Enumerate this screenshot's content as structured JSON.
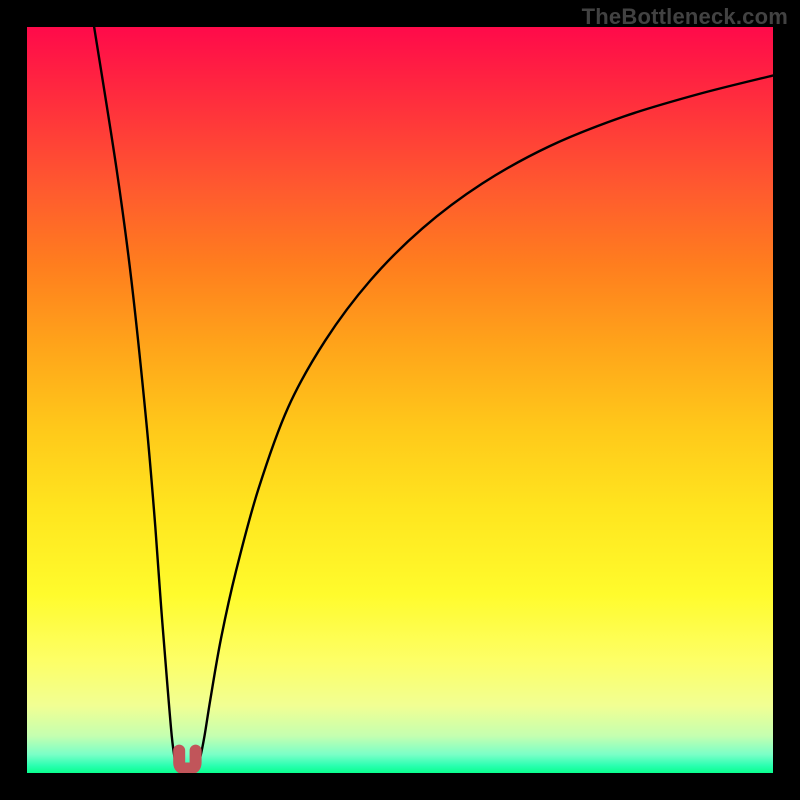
{
  "brand": "TheBottleneck.com",
  "chart_data": {
    "type": "line",
    "title": "",
    "xlabel": "",
    "ylabel": "",
    "xlim": [
      0,
      100
    ],
    "ylim": [
      0,
      100
    ],
    "curve_left": {
      "x": [
        9,
        12,
        14,
        16,
        17.2,
        18,
        18.8,
        19.4,
        19.8,
        20.2
      ],
      "y": [
        100,
        81,
        66,
        47,
        33,
        22,
        12,
        5,
        2,
        0.8
      ]
    },
    "curve_right": {
      "x": [
        22.8,
        23.2,
        23.8,
        24.6,
        26,
        28,
        31,
        35,
        40,
        46,
        53,
        61,
        70,
        80,
        90,
        100
      ],
      "y": [
        0.8,
        2,
        5,
        10,
        18,
        27,
        38,
        49,
        58,
        66,
        73,
        79,
        84,
        88,
        91,
        93.5
      ]
    },
    "notch": {
      "color": "#c1555a",
      "x_center": 21.5,
      "depth": 3.0,
      "width": 2.2
    },
    "gradient_colors": {
      "top": "#ff0a4a",
      "mid_upper": "#ffa51a",
      "mid": "#fffb2c",
      "bottom": "#09ff8e"
    }
  }
}
